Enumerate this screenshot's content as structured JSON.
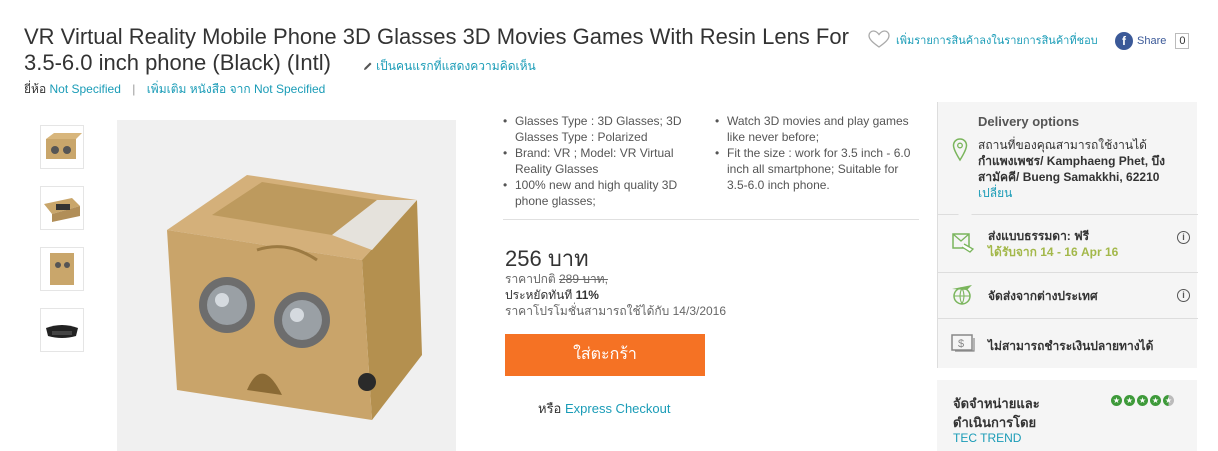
{
  "product": {
    "title": "VR Virtual Reality Mobile Phone 3D Glasses 3D Movies Games With Resin Lens For 3.5-6.0 inch phone (Black) (Intl)",
    "review_link": "เป็นคนแรกที่แสดงความคิดเห็น",
    "brand_label": "ยี่ห้อ",
    "brand_value": "Not Specified",
    "more_label": "เพิ่มเติม หนังสือ จาก",
    "more_value": "Not Specified"
  },
  "actions": {
    "wishlist": "เพิ่มรายการสินค้าลงในรายการสินค้าที่ชอบ",
    "share_label": "Share",
    "share_count": "0"
  },
  "gallery": {
    "thumbnails": [
      "thumb-1",
      "thumb-2",
      "thumb-3",
      "thumb-4"
    ]
  },
  "specs": {
    "col1": [
      "Glasses Type : 3D Glasses; 3D Glasses Type : Polarized",
      "Brand: VR ; Model: VR Virtual Reality Glasses",
      "100% new and high quality 3D phone glasses;"
    ],
    "col2": [
      "Watch 3D movies and play games like never before;",
      "Fit the size : work for 3.5 inch - 6.0 inch all smartphone; Suitable for 3.5-6.0 inch phone."
    ]
  },
  "pricing": {
    "price": "256 บาท",
    "regular_label": "ราคาปกติ",
    "regular_value": "289 บาท,",
    "save_label": "ประหยัดทันที",
    "save_value": "11%",
    "promo_text": "ราคาโปรโมชั่นสามารถใช้ได้กับ 14/3/2016"
  },
  "cart": {
    "add_label": "ใส่ตะกร้า",
    "or_label": "หรือ",
    "express_label": "Express Checkout"
  },
  "delivery": {
    "title": "Delivery options",
    "location_intro": "สถานที่ของคุณสามารถใช้งานได้",
    "location_address": "กำแพงเพชร/ Kamphaeng Phet, บึงสามัคคี/ Bueng Samakkhi, 62210",
    "change_label": "เปลี่ยน",
    "standard_label": "ส่งแบบธรรมดา: ฟรี",
    "standard_date": "ได้รับจาก 14 - 16 Apr 16",
    "overseas_label": "จัดส่งจากต่างประเทศ",
    "cod_label": "ไม่สามารถชำระเงินปลายทางได้"
  },
  "seller": {
    "label": "จัดจำหน่ายและดำเนินการโดย",
    "name": "TEC TREND",
    "rating": 4.5
  },
  "colors": {
    "accent": "#f57224",
    "link": "#1a9cb7",
    "green": "#a3b84a"
  }
}
